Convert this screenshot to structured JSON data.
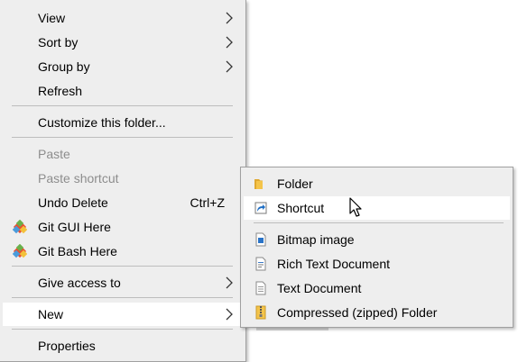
{
  "context_menu": {
    "items": [
      {
        "label": "View",
        "submenu": true
      },
      {
        "label": "Sort by",
        "submenu": true
      },
      {
        "label": "Group by",
        "submenu": true
      },
      {
        "label": "Refresh"
      },
      {
        "label": "Customize this folder..."
      },
      {
        "label": "Paste",
        "disabled": true
      },
      {
        "label": "Paste shortcut",
        "disabled": true
      },
      {
        "label": "Undo Delete",
        "shortcut": "Ctrl+Z"
      },
      {
        "label": "Git GUI Here",
        "icon": "git-icon"
      },
      {
        "label": "Git Bash Here",
        "icon": "git-icon"
      },
      {
        "label": "Give access to",
        "submenu": true
      },
      {
        "label": "New",
        "submenu": true,
        "highlighted": true
      },
      {
        "label": "Properties"
      }
    ]
  },
  "new_submenu": {
    "items": [
      {
        "label": "Folder",
        "icon": "folder-icon"
      },
      {
        "label": "Shortcut",
        "icon": "shortcut-icon",
        "highlighted": true
      },
      {
        "label": "Bitmap image",
        "icon": "bitmap-icon"
      },
      {
        "label": "Rich Text Document",
        "icon": "rich-text-document-icon"
      },
      {
        "label": "Text Document",
        "icon": "text-document-icon"
      },
      {
        "label": "Compressed (zipped) Folder",
        "icon": "zip-folder-icon"
      }
    ]
  },
  "colors": {
    "menu_background": "#eeeeee",
    "highlight": "#ffffff",
    "disabled_text": "#8d8d8d",
    "separator": "#bdbdbd",
    "folder_yellow": "#f4c44a",
    "shortcut_blue": "#1f6fc5"
  }
}
